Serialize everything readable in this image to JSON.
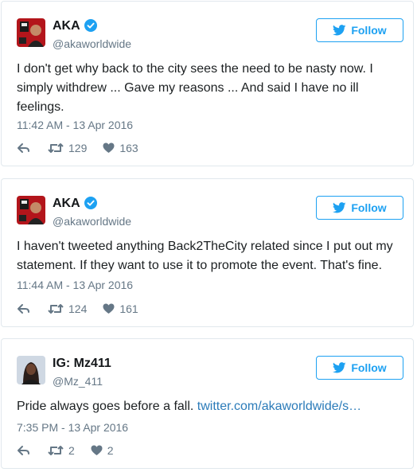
{
  "tweets": [
    {
      "name": "AKA",
      "handle": "@akaworldwide",
      "follow_label": "Follow",
      "text": "I don't get why back to the city sees the need to be nasty now. I simply withdrew ... Gave my reasons ... And said I have no ill feelings.",
      "timestamp": "11:42 AM - 13 Apr 2016",
      "retweets": "129",
      "likes": "163",
      "verified": true
    },
    {
      "name": "AKA",
      "handle": "@akaworldwide",
      "follow_label": "Follow",
      "text": "I haven't tweeted anything Back2TheCity related since I put out my statement. If they want to use it to promote the event. That's fine.",
      "timestamp": "11:44 AM - 13 Apr 2016",
      "retweets": "124",
      "likes": "161",
      "verified": true
    },
    {
      "name": "IG: Mz411",
      "handle": "@Mz_411",
      "follow_label": "Follow",
      "text": "Pride always goes before a fall.",
      "link": "twitter.com/akaworldwide/s…",
      "timestamp": "7:35 PM - 13 Apr 2016",
      "retweets": "2",
      "likes": "2",
      "verified": false
    }
  ],
  "colors": {
    "accent": "#1da1f2",
    "link": "#2b7bb9",
    "muted": "#657786",
    "border": "#e1e8ed"
  }
}
